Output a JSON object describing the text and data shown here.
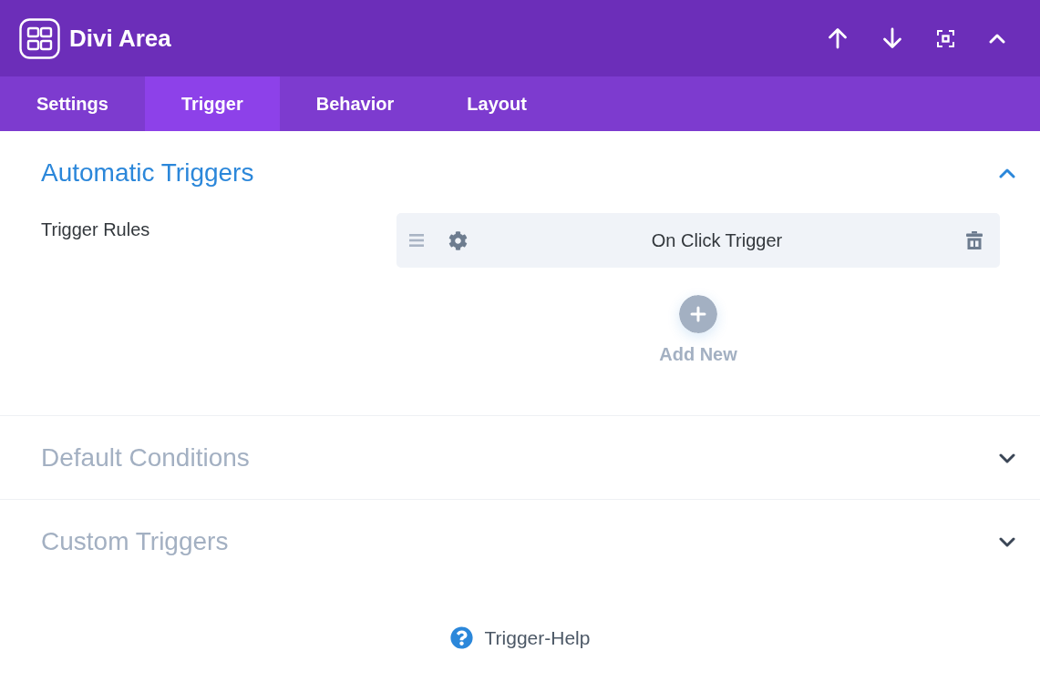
{
  "header": {
    "title": "Divi Area"
  },
  "tabs": [
    {
      "label": "Settings",
      "selected": false
    },
    {
      "label": "Trigger",
      "selected": true
    },
    {
      "label": "Behavior",
      "selected": false
    },
    {
      "label": "Layout",
      "selected": false
    }
  ],
  "sections": [
    {
      "title": "Automatic Triggers",
      "expanded": true,
      "field": {
        "label": "Trigger Rules",
        "rules": [
          {
            "name": "On Click Trigger"
          }
        ],
        "add_label": "Add New"
      }
    },
    {
      "title": "Default Conditions",
      "expanded": false
    },
    {
      "title": "Custom Triggers",
      "expanded": false
    }
  ],
  "help": {
    "label": "Trigger-Help"
  }
}
